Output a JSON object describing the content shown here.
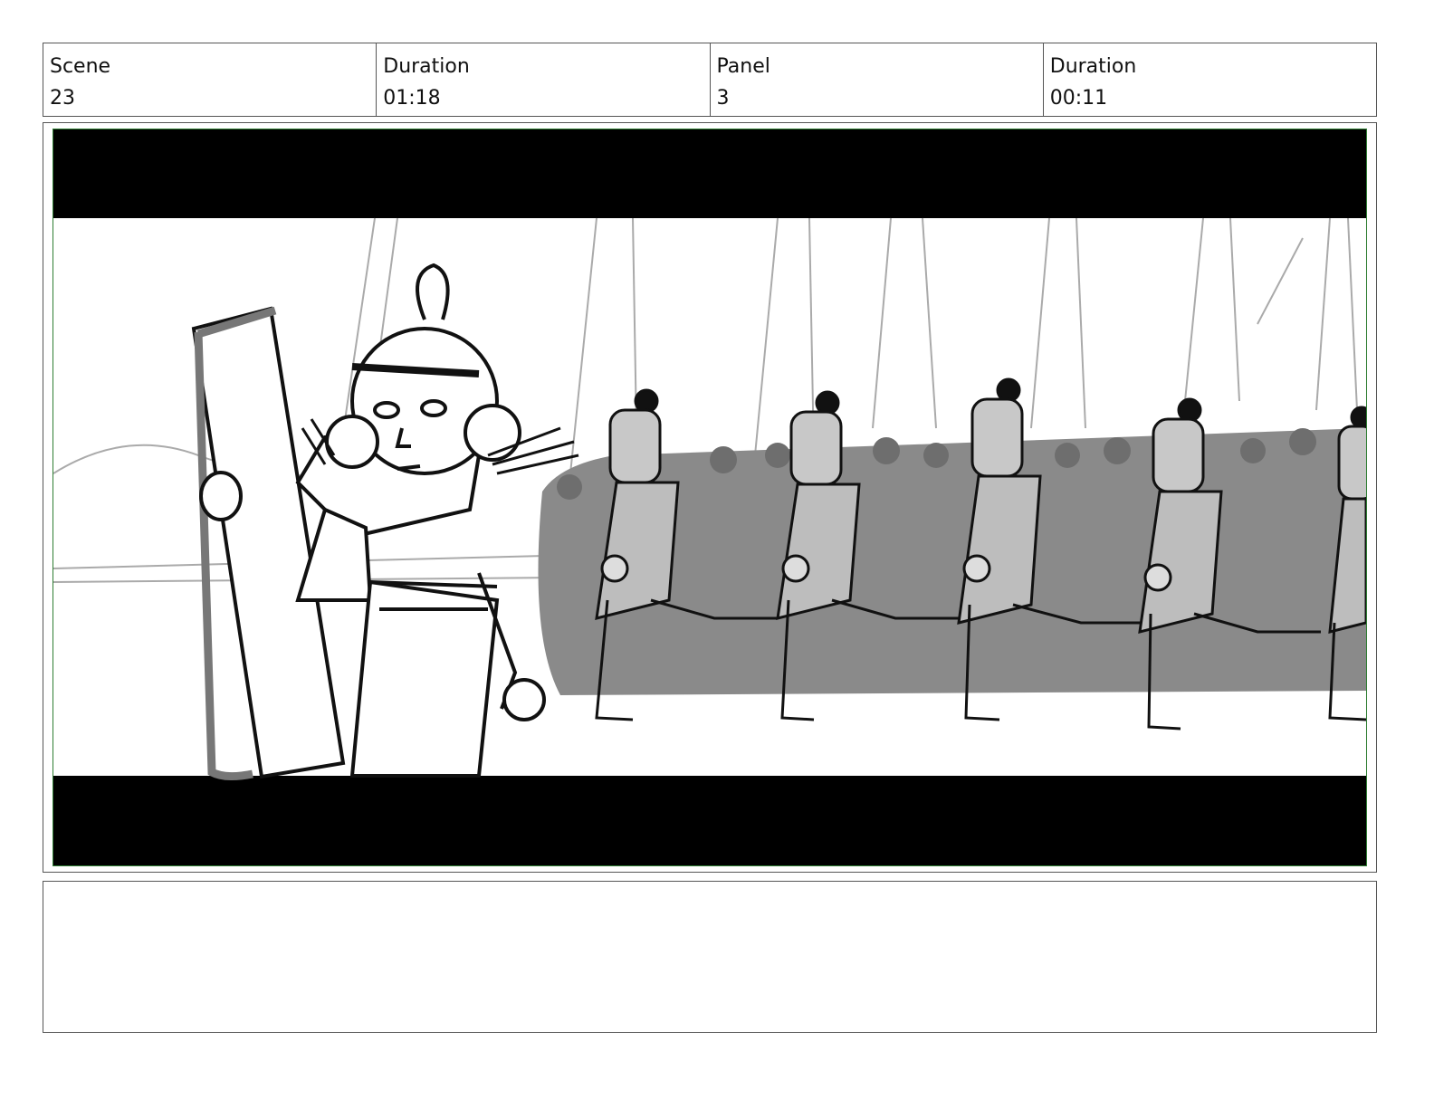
{
  "header": {
    "scene_label": "Scene",
    "scene_value": "23",
    "scene_duration_label": "Duration",
    "scene_duration_value": "01:18",
    "panel_label": "Panel",
    "panel_value": "3",
    "panel_duration_label": "Duration",
    "panel_duration_value": "00:11"
  },
  "panel": {
    "border_color": "#2e7d32",
    "letterbox_color": "#000000"
  },
  "notes": {
    "text": ""
  }
}
